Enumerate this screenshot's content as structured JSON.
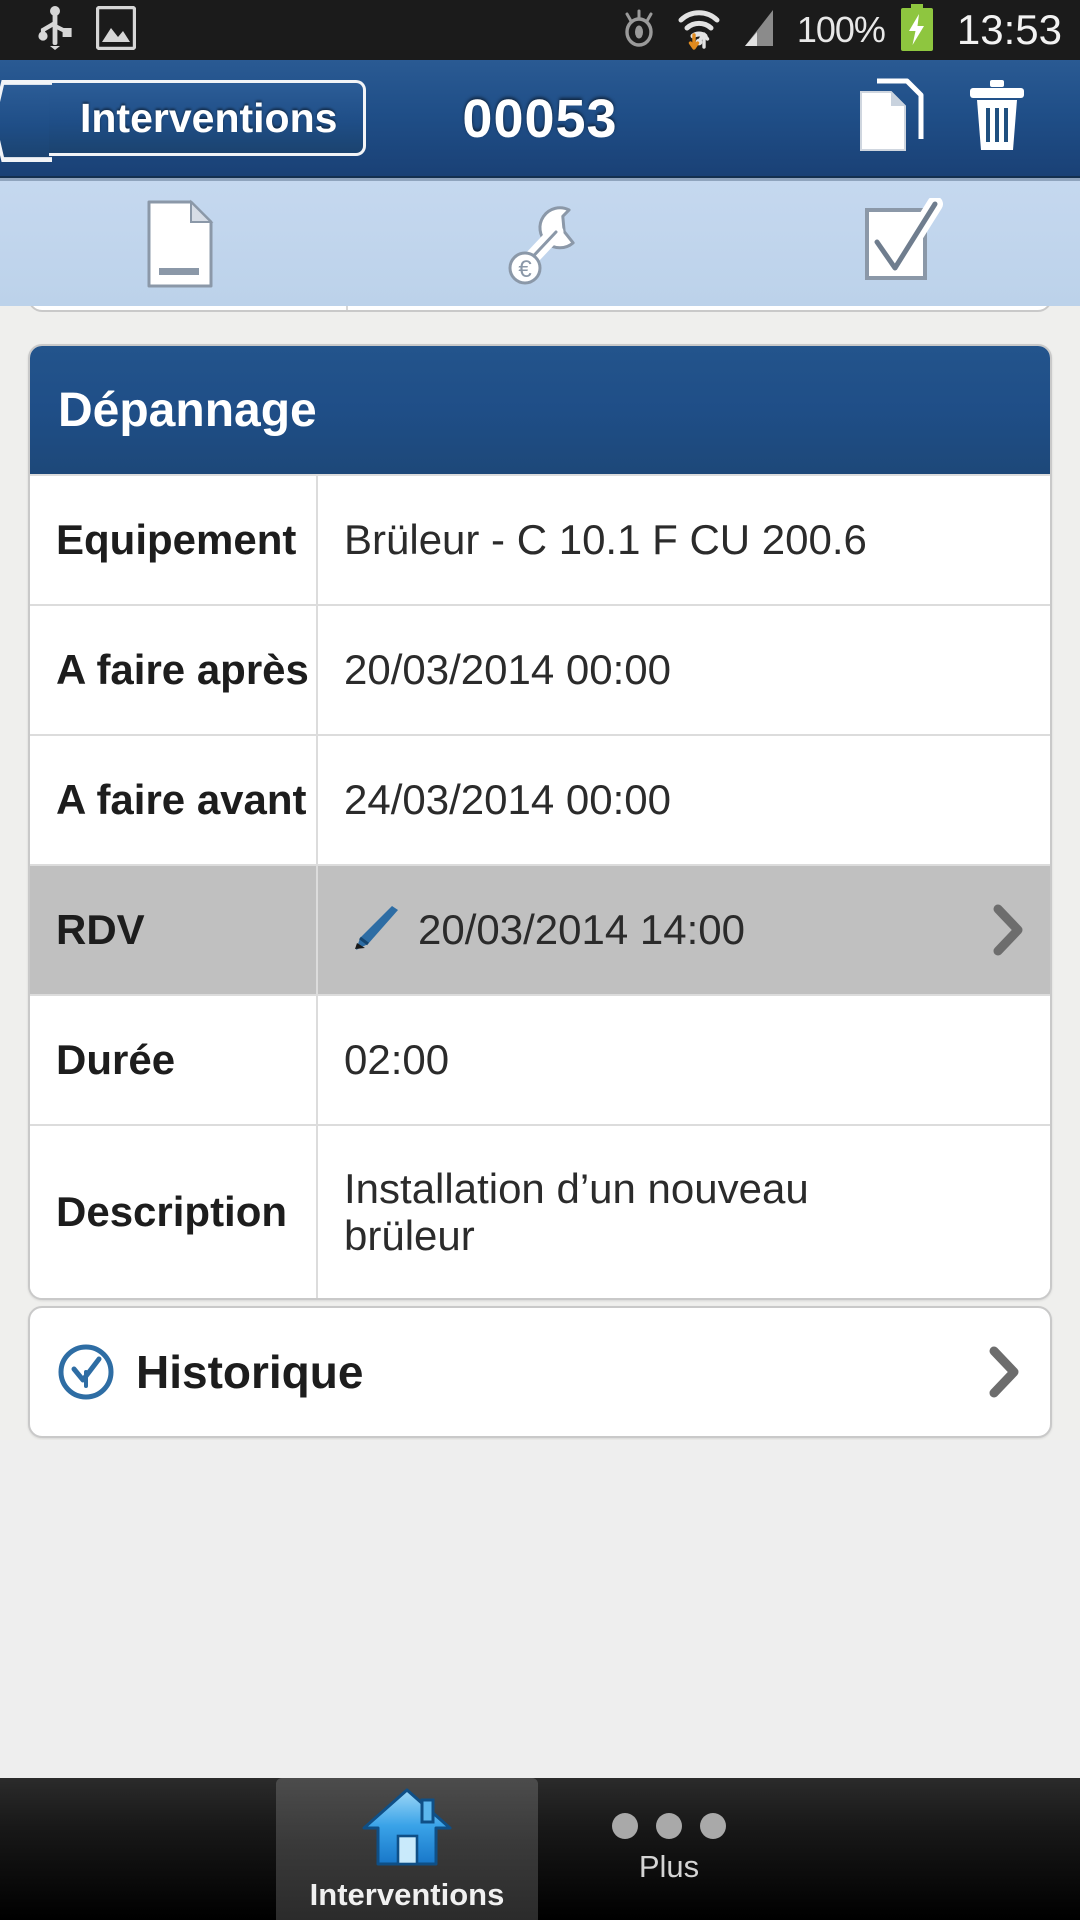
{
  "statusbar": {
    "icons_left": [
      "usb-icon",
      "gallery-icon"
    ],
    "icons_right": [
      "eye-icon",
      "wifi-icon",
      "signal-icon"
    ],
    "battery_percent": "100%",
    "battery_state": "charging",
    "clock": "13:53"
  },
  "navbar": {
    "back_label": "Interventions",
    "title": "00053",
    "copy_icon": "copy-icon",
    "delete_icon": "trash-icon"
  },
  "tabs": [
    {
      "icon": "document-icon",
      "name": "tab-document",
      "selected": true
    },
    {
      "icon": "wrench-icon",
      "name": "tab-wrench",
      "selected": false
    },
    {
      "icon": "checkbox-checked-icon",
      "name": "tab-checklist",
      "selected": false
    }
  ],
  "main_card": {
    "header": "Dépannage",
    "rows": [
      {
        "label": "Equipement",
        "value": "Brüleur - C 10.1 F CU 200.6",
        "highlight": false,
        "has_pencil": false,
        "has_chevron": false
      },
      {
        "label": "A faire après",
        "value": "20/03/2014 00:00",
        "highlight": false,
        "has_pencil": false,
        "has_chevron": false
      },
      {
        "label": "A faire avant",
        "value": "24/03/2014 00:00",
        "highlight": false,
        "has_pencil": false,
        "has_chevron": false
      },
      {
        "label": "RDV",
        "value": "20/03/2014 14:00",
        "highlight": true,
        "has_pencil": true,
        "has_chevron": true
      },
      {
        "label": "Durée",
        "value": "02:00",
        "highlight": false,
        "has_pencil": false,
        "has_chevron": false
      },
      {
        "label": "Description",
        "value": "Installation d’un nouveau brüleur",
        "highlight": false,
        "has_pencil": false,
        "has_chevron": false
      }
    ]
  },
  "historique_card": {
    "label": "Historique",
    "icon": "clock-check-icon",
    "chevron": "chevron-right-icon"
  },
  "bottombar": {
    "items": [
      {
        "label": "Interventions",
        "icon": "home-icon",
        "selected": true
      },
      {
        "label": "Plus",
        "icon": "more-dots-icon",
        "selected": false
      }
    ]
  },
  "colors": {
    "nav_blue": "#1f4e87",
    "tab_blue": "#bcd2ea",
    "page_bg": "#efefed",
    "highlight_gray": "#c0c0c0",
    "battery_green": "#8ec63f",
    "accent_blue": "#2e6da4"
  }
}
